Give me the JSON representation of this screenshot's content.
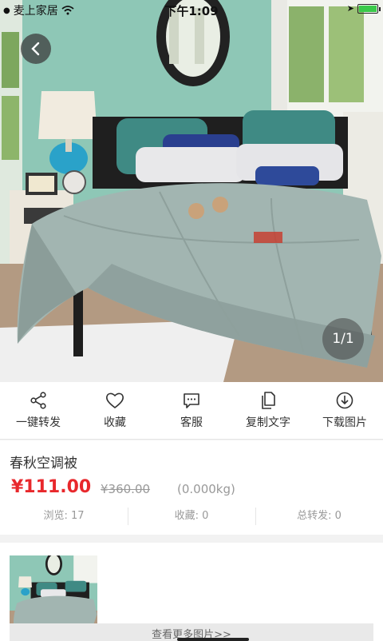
{
  "status_bar": {
    "carrier": "麦上家居",
    "time": "下午1:09"
  },
  "hero": {
    "page_indicator": "1/1"
  },
  "actions": [
    {
      "label": "一键转发",
      "icon": "share-icon"
    },
    {
      "label": "收藏",
      "icon": "heart-icon"
    },
    {
      "label": "客服",
      "icon": "chat-icon"
    },
    {
      "label": "复制文字",
      "icon": "copy-icon"
    },
    {
      "label": "下载图片",
      "icon": "download-icon"
    }
  ],
  "product": {
    "title": "春秋空调被",
    "price": "¥111.00",
    "original_price": "¥360.00",
    "weight": "(0.000kg)",
    "stats": {
      "views": "浏览: 17",
      "favorites": "收藏: 0",
      "forwards": "总转发: 0"
    }
  },
  "more": {
    "button_label": "查看更多图片>>"
  },
  "colors": {
    "price": "#e8282c",
    "battery": "#3ac94a"
  }
}
